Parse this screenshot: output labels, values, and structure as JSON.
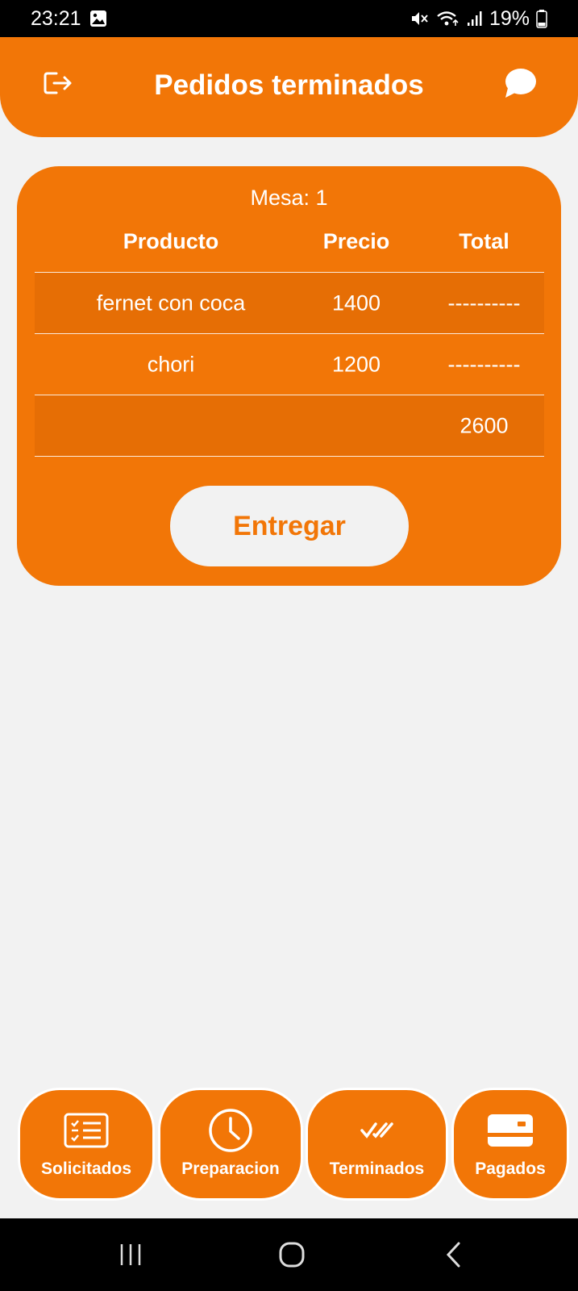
{
  "status_bar": {
    "time": "23:21",
    "battery": "19%"
  },
  "header": {
    "title": "Pedidos terminados",
    "left_icon": "logout-icon",
    "right_icon": "chat-bubble-icon"
  },
  "order": {
    "mesa_label": "Mesa: 1",
    "columns": [
      "Producto",
      "Precio",
      "Total"
    ],
    "rows": [
      {
        "producto": "fernet con coca",
        "precio": "1400",
        "total": "----------"
      },
      {
        "producto": "chori",
        "precio": "1200",
        "total": "----------"
      },
      {
        "producto": "",
        "precio": "",
        "total": "2600"
      }
    ],
    "action_label": "Entregar"
  },
  "bottom_nav": [
    {
      "label": "Solicitados",
      "icon": "checklist-icon"
    },
    {
      "label": "Preparacion",
      "icon": "clock-icon"
    },
    {
      "label": "Terminados",
      "icon": "double-check-icon"
    },
    {
      "label": "Pagados",
      "icon": "card-icon"
    }
  ],
  "colors": {
    "accent": "#f27607",
    "background": "#f2f2f2",
    "row_shade": "#e66e05"
  }
}
